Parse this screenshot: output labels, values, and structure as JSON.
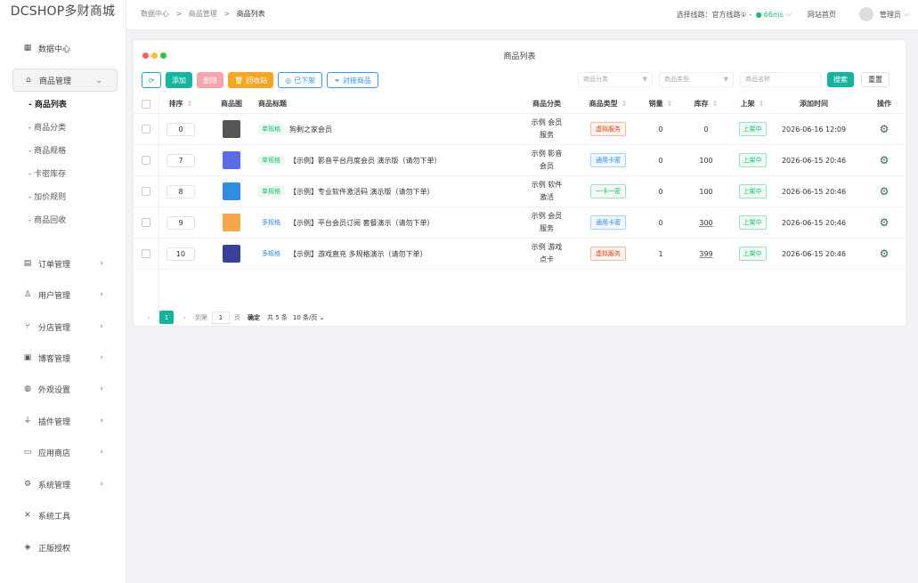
{
  "app": {
    "logo": "DCSHOP多财商城"
  },
  "sidebar": {
    "items": [
      {
        "label": "数据中心",
        "icon": "dashboard-icon"
      },
      {
        "label": "商品管理",
        "icon": "bag-icon",
        "expanded": true
      },
      {
        "label": "订单管理",
        "icon": "order-icon"
      },
      {
        "label": "用户管理",
        "icon": "user-icon"
      },
      {
        "label": "分店管理",
        "icon": "branch-icon"
      },
      {
        "label": "博客管理",
        "icon": "blog-icon"
      },
      {
        "label": "外观设置",
        "icon": "palette-icon"
      },
      {
        "label": "插件管理",
        "icon": "plug-icon"
      },
      {
        "label": "应用商店",
        "icon": "store-icon"
      },
      {
        "label": "系统管理",
        "icon": "settings-icon"
      },
      {
        "label": "系统工具",
        "icon": "tools-icon"
      },
      {
        "label": "正版授权",
        "icon": "shield-icon"
      }
    ],
    "subitems": [
      "商品列表",
      "商品分类",
      "商品规格",
      "卡密库存",
      "加价规则",
      "商品回收"
    ]
  },
  "header": {
    "breadcrumb": [
      "数据中心",
      "商品管理",
      "商品列表"
    ],
    "route_label": "选择线路：官方线路①",
    "latency": "66ms",
    "site_home": "网站首页",
    "admin": "管理员"
  },
  "card": {
    "title": "商品列表",
    "toolbar": {
      "add": "添加",
      "delete": "删除",
      "recycle": "回收站",
      "offshelf": "已下架",
      "dock": "对接商品"
    },
    "filters": {
      "category_placeholder": "商品分类",
      "type_placeholder": "商品类型",
      "name_placeholder": "商品名称",
      "search": "搜索",
      "reset": "重置"
    },
    "columns": [
      "排序",
      "商品图",
      "商品标题",
      "商品分类",
      "商品类型",
      "销量",
      "库存",
      "上架",
      "添加时间",
      "操作"
    ],
    "rows": [
      {
        "order": "0",
        "spec": "单规格",
        "title": "狗剩之家会员",
        "category_line1": "示例 会员",
        "category_line2": "服务",
        "type": "虚拟服务",
        "type_color": "red",
        "sales": "0",
        "stock": "0",
        "shelf": "上架中",
        "time": "2026-06-16 12:09",
        "thumb_color": "#555555"
      },
      {
        "order": "7",
        "spec": "单规格",
        "title": "【示例】影音平台月度会员 演示版（请勿下单）",
        "category_line1": "示例 影音",
        "category_line2": "会员",
        "type": "通用卡密",
        "type_color": "blue",
        "sales": "0",
        "stock": "100",
        "shelf": "上架中",
        "time": "2026-06-15 20:46",
        "thumb_color": "#5b6ee8"
      },
      {
        "order": "8",
        "spec": "单规格",
        "title": "【示例】专业软件激活码 演示版（请勿下单）",
        "category_line1": "示例 软件",
        "category_line2": "激活",
        "type": "一卡一密",
        "type_color": "green",
        "sales": "0",
        "stock": "100",
        "shelf": "上架中",
        "time": "2026-06-15 20:46",
        "thumb_color": "#2f8de4"
      },
      {
        "order": "9",
        "spec": "多规格",
        "title": "【示例】平台会员订阅 套餐演示（请勿下单）",
        "category_line1": "示例 会员",
        "category_line2": "服务",
        "type": "通用卡密",
        "type_color": "blue",
        "sales": "0",
        "stock": "300",
        "shelf": "上架中",
        "time": "2026-06-15 20:46",
        "thumb_color": "#f4a64a"
      },
      {
        "order": "10",
        "spec": "多规格",
        "title": "【示例】游戏直充 多规格演示（请勿下单）",
        "category_line1": "示例 游戏",
        "category_line2": "点卡",
        "type": "虚拟服务",
        "type_color": "red",
        "sales": "1",
        "stock": "399",
        "shelf": "上架中",
        "time": "2026-06-15 20:46",
        "thumb_color": "#3a3f9a"
      }
    ]
  },
  "pager": {
    "current": "1",
    "goto_label": "到第",
    "goto_value": "1",
    "page_unit": "页",
    "confirm": "确定",
    "total": "共 5 条",
    "page_size": "10 条/页"
  },
  "colors": {
    "accent": "#13b5a0",
    "danger": "#ed4014",
    "primary": "#2d8cf0"
  }
}
